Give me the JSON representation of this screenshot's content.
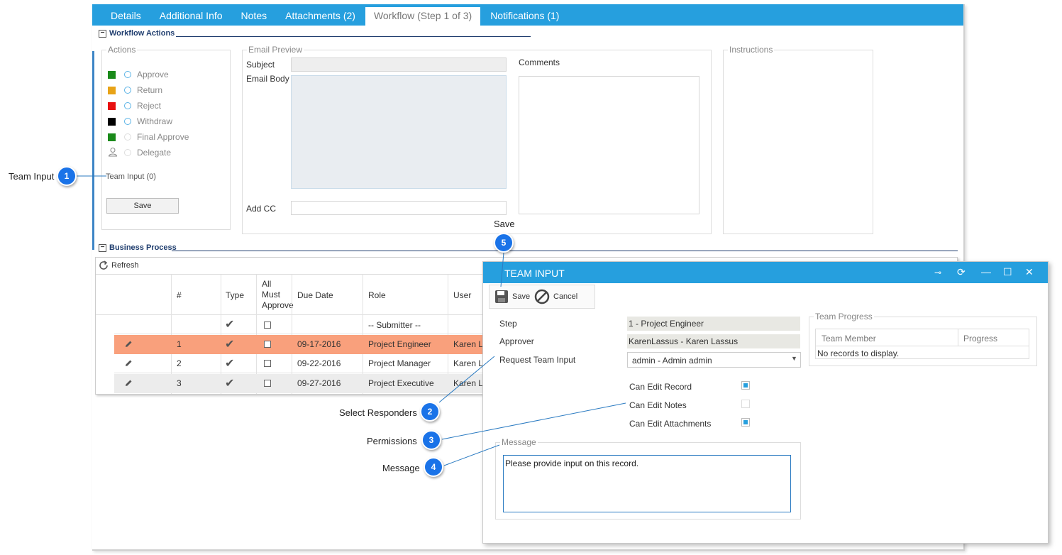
{
  "tabs": [
    "Details",
    "Additional Info",
    "Notes",
    "Attachments (2)",
    "Workflow (Step 1 of 3)",
    "Notifications (1)"
  ],
  "workflow_actions": {
    "title": "Workflow Actions",
    "actions_legend": "Actions",
    "actions": [
      {
        "label": "Approve",
        "color": "#1a8a1a"
      },
      {
        "label": "Return",
        "color": "#e8a317"
      },
      {
        "label": "Reject",
        "color": "#e81010"
      },
      {
        "label": "Withdraw",
        "color": "#000000"
      },
      {
        "label": "Final Approve",
        "color": "#1a8a1a"
      },
      {
        "label": "Delegate",
        "color": ""
      }
    ],
    "team_input_link": "Team Input (0)",
    "save_label": "Save",
    "email_preview_legend": "Email Preview",
    "subject_label": "Subject",
    "email_body_label": "Email Body",
    "add_cc_label": "Add CC",
    "comments_label": "Comments",
    "instructions_legend": "Instructions"
  },
  "business_process": {
    "title": "Business Process",
    "refresh_label": "Refresh",
    "headers": {
      "num": "#",
      "type": "Type",
      "all_must_approve": "All\nMust\nApprove",
      "due_date": "Due Date",
      "role": "Role",
      "user": "User"
    },
    "submitter_row": {
      "role": "-- Submitter --"
    },
    "rows": [
      {
        "num": "1",
        "due_date": "09-17-2016",
        "role": "Project Engineer",
        "user": "Karen L"
      },
      {
        "num": "2",
        "due_date": "09-22-2016",
        "role": "Project Manager",
        "user": "Karen L"
      },
      {
        "num": "3",
        "due_date": "09-27-2016",
        "role": "Project Executive",
        "user": "Karen L"
      }
    ],
    "highlight_color": "#f9a07c"
  },
  "dialog": {
    "title": "TEAM INPUT",
    "save_label": "Save",
    "cancel_label": "Cancel",
    "step_label": "Step",
    "step_value": "1 - Project Engineer",
    "approver_label": "Approver",
    "approver_value": "KarenLassus - Karen Lassus",
    "request_label": "Request Team Input",
    "request_value": "admin - Admin admin",
    "can_edit_record": "Can Edit Record",
    "can_edit_notes": "Can Edit Notes",
    "can_edit_attachments": "Can Edit Attachments",
    "message_legend": "Message",
    "message_value": "Please provide input on this record.",
    "team_progress_legend": "Team Progress",
    "team_member_header": "Team Member",
    "progress_header": "Progress",
    "no_records": "No records to display."
  },
  "callouts": [
    {
      "num": "1",
      "label": "Team Input"
    },
    {
      "num": "2",
      "label": "Select Responders"
    },
    {
      "num": "3",
      "label": "Permissions"
    },
    {
      "num": "4",
      "label": "Message"
    },
    {
      "num": "5",
      "label": "Save"
    }
  ],
  "accent_color": "#269fde"
}
